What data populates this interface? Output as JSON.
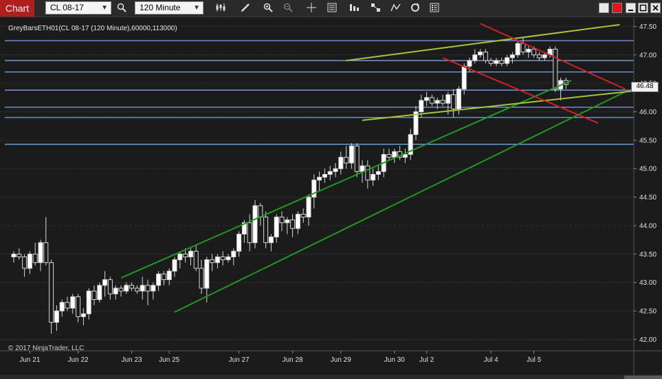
{
  "toolbar": {
    "tab_label": "Chart",
    "instrument": "CL 08-17",
    "interval": "120 Minute"
  },
  "chart_data": {
    "type": "candlestick",
    "title": "GreyBarsETH01(CL 08-17 (120 Minute),60000,113000)",
    "copyright": "© 2017 NinjaTrader, LLC",
    "ylim": [
      41.8,
      47.65
    ],
    "y_ticks": [
      42.0,
      42.5,
      43.0,
      43.5,
      44.0,
      44.5,
      45.0,
      45.5,
      46.0,
      46.5,
      47.0,
      47.5
    ],
    "x_ticks": [
      {
        "label": "Jun 21",
        "bar": 3
      },
      {
        "label": "Jun 22",
        "bar": 12
      },
      {
        "label": "Jun 23",
        "bar": 22
      },
      {
        "label": "Jun 25",
        "bar": 29
      },
      {
        "label": "Jun 27",
        "bar": 42
      },
      {
        "label": "Jun 28",
        "bar": 52
      },
      {
        "label": "Jun 29",
        "bar": 61
      },
      {
        "label": "Jun 30",
        "bar": 71
      },
      {
        "label": "Jul 2",
        "bar": 77
      },
      {
        "label": "Jul 4",
        "bar": 89
      },
      {
        "label": "Jul 5",
        "bar": 97
      }
    ],
    "current_price": 46.48,
    "grid": true,
    "candles": [
      [
        43.45,
        43.55,
        43.35,
        43.5
      ],
      [
        43.5,
        43.6,
        43.4,
        43.45
      ],
      [
        43.45,
        43.5,
        43.1,
        43.25
      ],
      [
        43.25,
        43.55,
        43.15,
        43.5
      ],
      [
        43.5,
        43.7,
        43.3,
        43.35
      ],
      [
        43.35,
        43.75,
        43.2,
        43.7
      ],
      [
        43.7,
        44.15,
        43.3,
        43.35
      ],
      [
        43.35,
        43.4,
        42.1,
        42.3
      ],
      [
        42.3,
        42.6,
        42.15,
        42.5
      ],
      [
        42.5,
        42.7,
        42.4,
        42.65
      ],
      [
        42.65,
        42.75,
        42.5,
        42.55
      ],
      [
        42.55,
        42.8,
        42.45,
        42.75
      ],
      [
        42.75,
        42.8,
        42.3,
        42.4
      ],
      [
        42.4,
        42.55,
        42.25,
        42.45
      ],
      [
        42.45,
        42.9,
        42.35,
        42.85
      ],
      [
        42.85,
        42.95,
        42.6,
        42.7
      ],
      [
        42.7,
        43.0,
        42.65,
        42.95
      ],
      [
        42.95,
        43.2,
        42.75,
        43.05
      ],
      [
        43.05,
        43.1,
        42.7,
        42.8
      ],
      [
        42.8,
        42.95,
        42.7,
        42.9
      ],
      [
        42.9,
        42.95,
        42.75,
        42.85
      ],
      [
        42.85,
        43.0,
        42.8,
        42.95
      ],
      [
        42.95,
        43.0,
        42.85,
        42.9
      ],
      [
        42.9,
        42.95,
        42.8,
        42.85
      ],
      [
        42.85,
        43.1,
        42.7,
        42.95
      ],
      [
        42.95,
        43.05,
        42.6,
        42.85
      ],
      [
        42.85,
        43.0,
        42.7,
        42.95
      ],
      [
        42.95,
        43.2,
        42.85,
        43.15
      ],
      [
        43.15,
        43.2,
        42.95,
        43.05
      ],
      [
        43.05,
        43.25,
        42.95,
        43.2
      ],
      [
        43.2,
        43.45,
        43.1,
        43.4
      ],
      [
        43.4,
        43.55,
        43.25,
        43.5
      ],
      [
        43.5,
        43.6,
        43.35,
        43.45
      ],
      [
        43.45,
        43.6,
        43.3,
        43.55
      ],
      [
        43.55,
        43.65,
        43.2,
        43.25
      ],
      [
        43.25,
        43.4,
        42.8,
        42.9
      ],
      [
        42.9,
        43.45,
        42.65,
        43.4
      ],
      [
        43.4,
        43.5,
        43.2,
        43.35
      ],
      [
        43.35,
        43.5,
        43.25,
        43.45
      ],
      [
        43.45,
        43.55,
        43.3,
        43.4
      ],
      [
        43.4,
        43.5,
        43.35,
        43.45
      ],
      [
        43.45,
        43.6,
        43.3,
        43.55
      ],
      [
        43.55,
        43.9,
        43.45,
        43.85
      ],
      [
        43.85,
        44.1,
        43.7,
        44.05
      ],
      [
        44.05,
        44.2,
        43.55,
        43.7
      ],
      [
        43.7,
        44.45,
        43.6,
        44.35
      ],
      [
        44.35,
        44.4,
        44.0,
        44.15
      ],
      [
        44.15,
        44.25,
        43.6,
        43.7
      ],
      [
        43.7,
        43.85,
        43.55,
        43.8
      ],
      [
        43.8,
        44.2,
        43.7,
        44.15
      ],
      [
        44.15,
        44.25,
        43.9,
        44.05
      ],
      [
        44.05,
        44.15,
        43.85,
        44.1
      ],
      [
        44.1,
        44.2,
        43.8,
        43.95
      ],
      [
        43.95,
        44.25,
        43.85,
        44.2
      ],
      [
        44.2,
        44.3,
        44.05,
        44.15
      ],
      [
        44.15,
        44.55,
        44.0,
        44.5
      ],
      [
        44.5,
        44.9,
        44.3,
        44.8
      ],
      [
        44.8,
        44.95,
        44.6,
        44.85
      ],
      [
        44.85,
        45.0,
        44.75,
        44.9
      ],
      [
        44.9,
        45.05,
        44.8,
        44.95
      ],
      [
        44.95,
        45.1,
        44.85,
        45.0
      ],
      [
        45.0,
        45.3,
        44.9,
        45.2
      ],
      [
        45.2,
        45.4,
        45.0,
        45.1
      ],
      [
        45.1,
        45.45,
        45.0,
        45.4
      ],
      [
        45.4,
        45.45,
        44.85,
        44.95
      ],
      [
        44.95,
        45.15,
        44.75,
        45.05
      ],
      [
        45.05,
        45.15,
        44.65,
        44.8
      ],
      [
        44.8,
        45.0,
        44.7,
        44.9
      ],
      [
        44.9,
        45.05,
        44.8,
        44.95
      ],
      [
        44.95,
        45.35,
        44.85,
        45.25
      ],
      [
        45.25,
        45.35,
        45.15,
        45.2
      ],
      [
        45.2,
        45.35,
        45.1,
        45.3
      ],
      [
        45.3,
        45.4,
        45.15,
        45.2
      ],
      [
        45.2,
        45.35,
        45.1,
        45.25
      ],
      [
        45.25,
        45.7,
        45.15,
        45.6
      ],
      [
        45.6,
        46.1,
        45.5,
        46.0
      ],
      [
        46.0,
        46.3,
        45.9,
        46.2
      ],
      [
        46.2,
        46.35,
        46.1,
        46.25
      ],
      [
        46.25,
        46.3,
        46.1,
        46.15
      ],
      [
        46.15,
        46.25,
        46.05,
        46.2
      ],
      [
        46.2,
        46.3,
        46.1,
        46.15
      ],
      [
        46.15,
        46.35,
        45.95,
        46.3
      ],
      [
        46.3,
        46.4,
        45.9,
        46.05
      ],
      [
        46.05,
        46.45,
        45.95,
        46.4
      ],
      [
        46.4,
        46.85,
        46.3,
        46.8
      ],
      [
        46.8,
        46.95,
        46.7,
        46.9
      ],
      [
        46.9,
        47.1,
        46.85,
        47.0
      ],
      [
        47.0,
        47.1,
        46.95,
        47.05
      ],
      [
        47.05,
        47.1,
        46.85,
        46.9
      ],
      [
        46.9,
        46.95,
        46.8,
        46.85
      ],
      [
        46.85,
        46.95,
        46.8,
        46.9
      ],
      [
        46.9,
        46.95,
        46.8,
        46.85
      ],
      [
        46.85,
        47.0,
        46.8,
        46.95
      ],
      [
        46.95,
        47.05,
        46.85,
        47.0
      ],
      [
        47.0,
        47.25,
        46.95,
        47.2
      ],
      [
        47.2,
        47.3,
        47.0,
        47.05
      ],
      [
        47.05,
        47.15,
        46.95,
        47.1
      ],
      [
        47.1,
        47.15,
        46.95,
        47.0
      ],
      [
        47.0,
        47.05,
        46.9,
        46.95
      ],
      [
        46.95,
        47.05,
        46.9,
        47.0
      ],
      [
        47.0,
        47.15,
        46.95,
        47.1
      ],
      [
        47.1,
        47.15,
        46.35,
        46.4
      ],
      [
        46.4,
        46.6,
        46.2,
        46.55
      ],
      [
        46.55,
        46.6,
        46.4,
        46.48
      ]
    ],
    "horizontal_lines": [
      47.25,
      46.9,
      46.7,
      46.38,
      46.08,
      45.9,
      45.43
    ],
    "trend_lines": [
      {
        "color": "#1f9a1f",
        "from": [
          20,
          43.08
        ],
        "to": [
          104,
          46.55
        ]
      },
      {
        "color": "#1f9a1f",
        "from": [
          30,
          42.48
        ],
        "to": [
          114,
          46.35
        ]
      },
      {
        "color": "#a5c63a",
        "from": [
          62,
          46.9
        ],
        "to": [
          113,
          47.53
        ]
      },
      {
        "color": "#a5c63a",
        "from": [
          65,
          45.85
        ],
        "to": [
          117,
          46.38
        ]
      },
      {
        "color": "#d41f2a",
        "from": [
          87,
          47.55
        ],
        "to": [
          114,
          46.4
        ]
      },
      {
        "color": "#d41f2a",
        "from": [
          80,
          46.95
        ],
        "to": [
          109,
          45.8
        ]
      }
    ]
  }
}
